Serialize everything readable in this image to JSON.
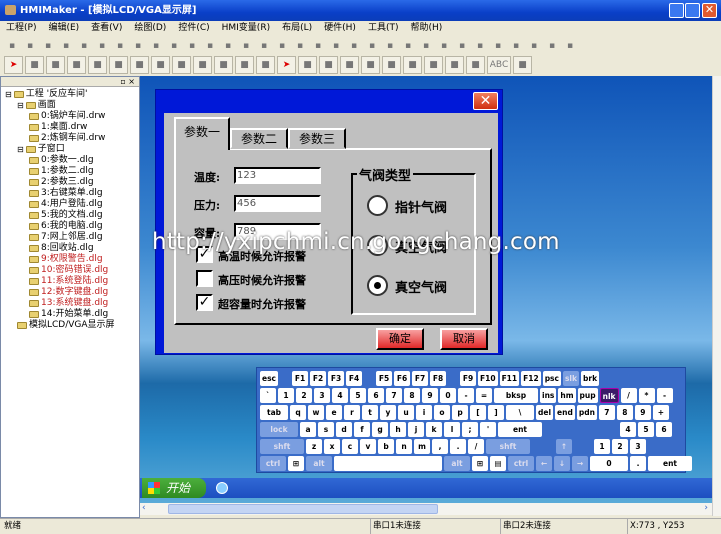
{
  "window": {
    "title": "HMIMaker - [模拟LCD/VGA显示屏]"
  },
  "menu": [
    "工程(P)",
    "编辑(E)",
    "查看(V)",
    "绘图(D)",
    "控件(C)",
    "HMI变量(R)",
    "布局(L)",
    "硬件(H)",
    "工具(T)",
    "帮助(H)"
  ],
  "toolbar2_text": "ABC",
  "tree": [
    {
      "label": "工程 '反应车间'",
      "level": 0
    },
    {
      "label": "画面",
      "level": 1
    },
    {
      "label": "0:锅炉车间.drw",
      "level": 2
    },
    {
      "label": "1:桌面.drw",
      "level": 2
    },
    {
      "label": "2:炼钢车间.drw",
      "level": 2
    },
    {
      "label": "子窗口",
      "level": 1
    },
    {
      "label": "0:参数一.dlg",
      "level": 2
    },
    {
      "label": "1:参数二.dlg",
      "level": 2
    },
    {
      "label": "2:参数三.dlg",
      "level": 2
    },
    {
      "label": "3:右键菜单.dlg",
      "level": 2
    },
    {
      "label": "4:用户登陆.dlg",
      "level": 2
    },
    {
      "label": "5:我的文档.dlg",
      "level": 2
    },
    {
      "label": "6:我的电脑.dlg",
      "level": 2
    },
    {
      "label": "7:网上邻居.dlg",
      "level": 2
    },
    {
      "label": "8:回收站.dlg",
      "level": 2
    },
    {
      "label": "9:权限警告.dlg",
      "level": 2,
      "red": true
    },
    {
      "label": "10:密码错误.dlg",
      "level": 2,
      "red": true
    },
    {
      "label": "11:系统登陆.dlg",
      "level": 2,
      "red": true
    },
    {
      "label": "12:数字键盘.dlg",
      "level": 2,
      "red": true
    },
    {
      "label": "13:系统键盘.dlg",
      "level": 2,
      "red": true
    },
    {
      "label": "14:开始菜单.dlg",
      "level": 2
    },
    {
      "label": "模拟LCD/VGA显示屏",
      "level": 1
    }
  ],
  "dialog": {
    "tabs": [
      "参数一",
      "参数二",
      "参数三"
    ],
    "fields": [
      {
        "label": "温度:",
        "value": "123"
      },
      {
        "label": "压力:",
        "value": "456"
      },
      {
        "label": "容量:",
        "value": "789"
      }
    ],
    "checkboxes": [
      {
        "label": "高温时候允许报警",
        "checked": true
      },
      {
        "label": "高压时候允许报警",
        "checked": false
      },
      {
        "label": "超容量时允许报警",
        "checked": true
      }
    ],
    "group_title": "气阀类型",
    "radios": [
      {
        "label": "指针气阀",
        "selected": false
      },
      {
        "label": "真空气阀",
        "selected": false
      },
      {
        "label": "真空气阀",
        "selected": true
      }
    ],
    "ok": "确定",
    "cancel": "取消",
    "close": "✕"
  },
  "watermark": "http://yxipchmi.cn.gongchang.com",
  "keyboard": {
    "rows": [
      [
        "esc",
        "F1",
        "F2",
        "F3",
        "F4",
        "F5",
        "F6",
        "F7",
        "F8",
        "F9",
        "F10",
        "F11",
        "F12",
        "psc",
        "slk",
        "brk"
      ],
      [
        "`",
        "1",
        "2",
        "3",
        "4",
        "5",
        "6",
        "7",
        "8",
        "9",
        "0",
        "-",
        "=",
        "bksp",
        "ins",
        "hm",
        "pup",
        "nlk",
        "/",
        "*",
        "-"
      ],
      [
        "tab",
        "q",
        "w",
        "e",
        "r",
        "t",
        "y",
        "u",
        "i",
        "o",
        "p",
        "[",
        "]",
        "\\",
        "del",
        "end",
        "pdn",
        "7",
        "8",
        "9",
        "+"
      ],
      [
        "lock",
        "a",
        "s",
        "d",
        "f",
        "g",
        "h",
        "j",
        "k",
        "l",
        ";",
        "'",
        "ent",
        "4",
        "5",
        "6"
      ],
      [
        "shft",
        "z",
        "x",
        "c",
        "v",
        "b",
        "n",
        "m",
        ",",
        ".",
        "/",
        "shft",
        "↑",
        "1",
        "2",
        "3"
      ],
      [
        "ctrl",
        "⊞",
        "alt",
        " ",
        "alt",
        "⊞",
        "▤",
        "ctrl",
        "←",
        "↓",
        "→",
        "0",
        ".",
        "ent"
      ]
    ]
  },
  "taskbar": {
    "start": "开始"
  },
  "status": {
    "ready": "就绪",
    "port1": "串口1未连接",
    "port2": "串口2未连接",
    "coords": "X:773 , Y253"
  }
}
